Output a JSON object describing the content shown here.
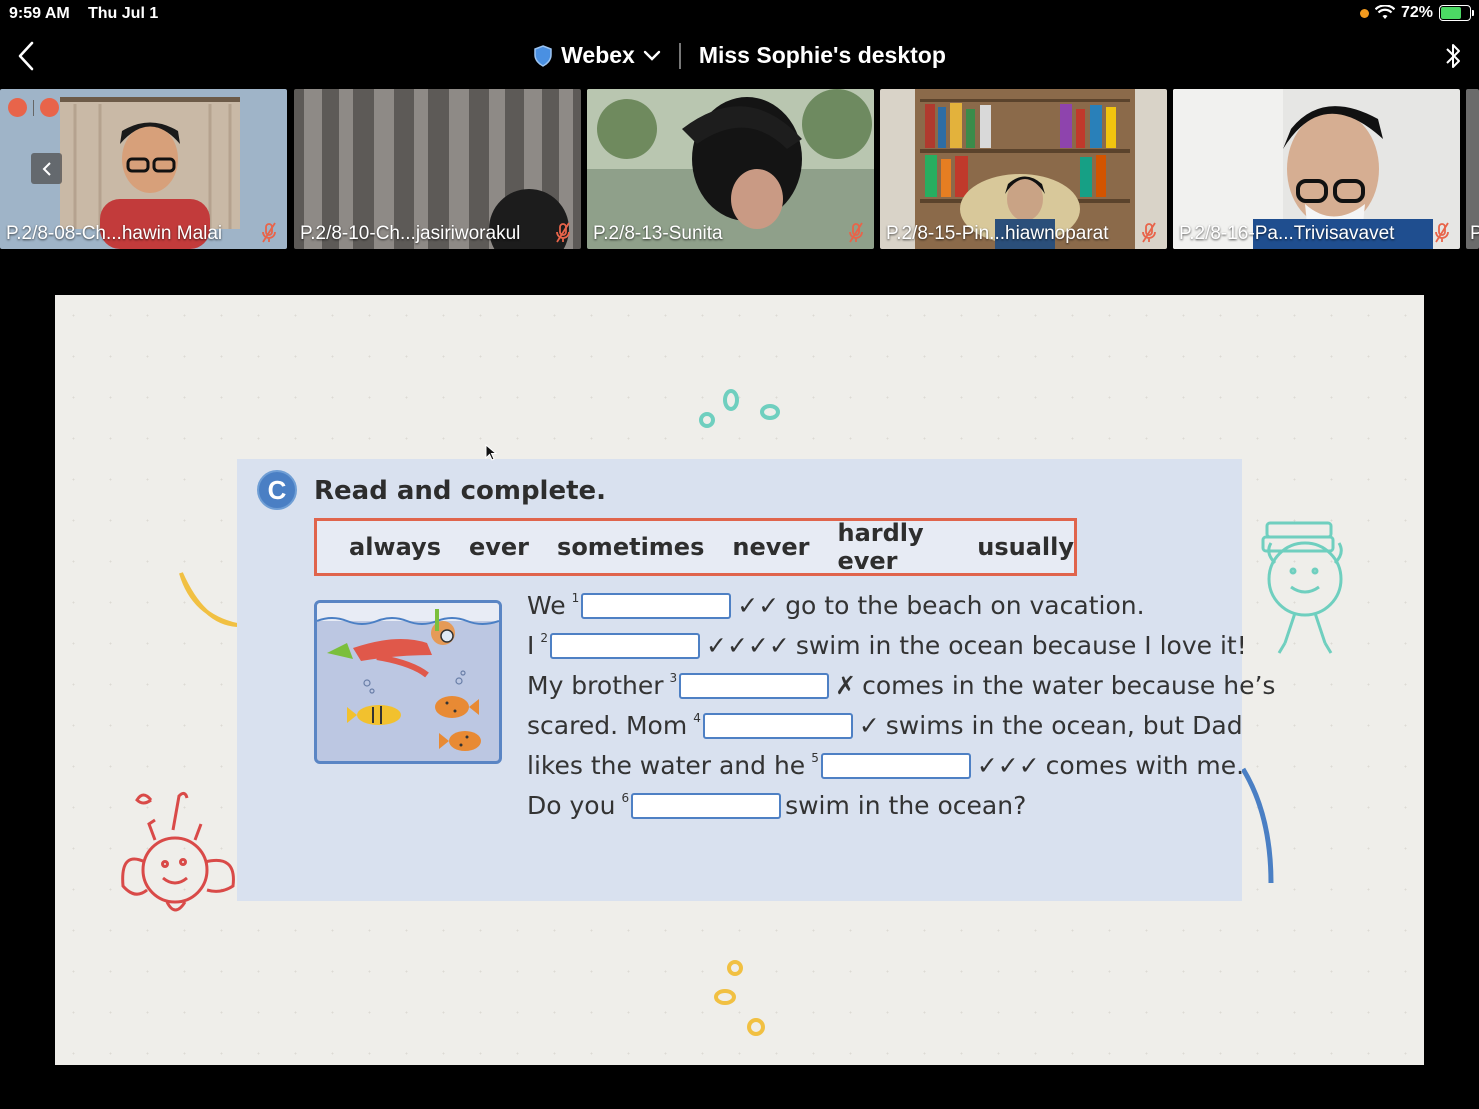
{
  "status": {
    "time": "9:59 AM",
    "date": "Thu Jul 1",
    "battery": "72%"
  },
  "header": {
    "app_name": "Webex",
    "share_title": "Miss Sophie's desktop"
  },
  "participants": [
    {
      "name": "P.2/8-08-Ch...hawin Malai",
      "muted": true
    },
    {
      "name": "P.2/8-10-Ch...jasiriworakul",
      "muted": true
    },
    {
      "name": "P.2/8-13-Sunita",
      "muted": true
    },
    {
      "name": "P.2/8-15-Pin...hiawnoparat",
      "muted": true
    },
    {
      "name": "P.2/8-16-Pa...Trivisavavet",
      "muted": true
    },
    {
      "name": "P",
      "muted": true
    }
  ],
  "exercise": {
    "badge": "C",
    "heading": "Read and complete.",
    "words": [
      "always",
      "ever",
      "sometimes",
      "never",
      "hardly ever",
      "usually"
    ],
    "lines": [
      {
        "before": "We",
        "num": "1",
        "marks": "✓✓",
        "after": "go to the beach on vacation."
      },
      {
        "before": "I",
        "num": "2",
        "marks": "✓✓✓✓",
        "after": "swim in the ocean because I love it!"
      },
      {
        "before": "My brother",
        "num": "3",
        "marks": "✗",
        "after": "comes in the water because he’s"
      },
      {
        "before": "scared. Mom",
        "num": "4",
        "marks": "✓",
        "after": "swims in the ocean, but Dad"
      },
      {
        "before": "likes the water and he",
        "num": "5",
        "marks": "✓✓✓",
        "after": "comes with me."
      },
      {
        "before": "Do you",
        "num": "6",
        "marks": "",
        "after": "swim in the ocean?"
      }
    ]
  },
  "colors": {
    "accent_red": "#e0644c",
    "accent_blue": "#4a7fc4",
    "panel": "#d9e1ef"
  }
}
